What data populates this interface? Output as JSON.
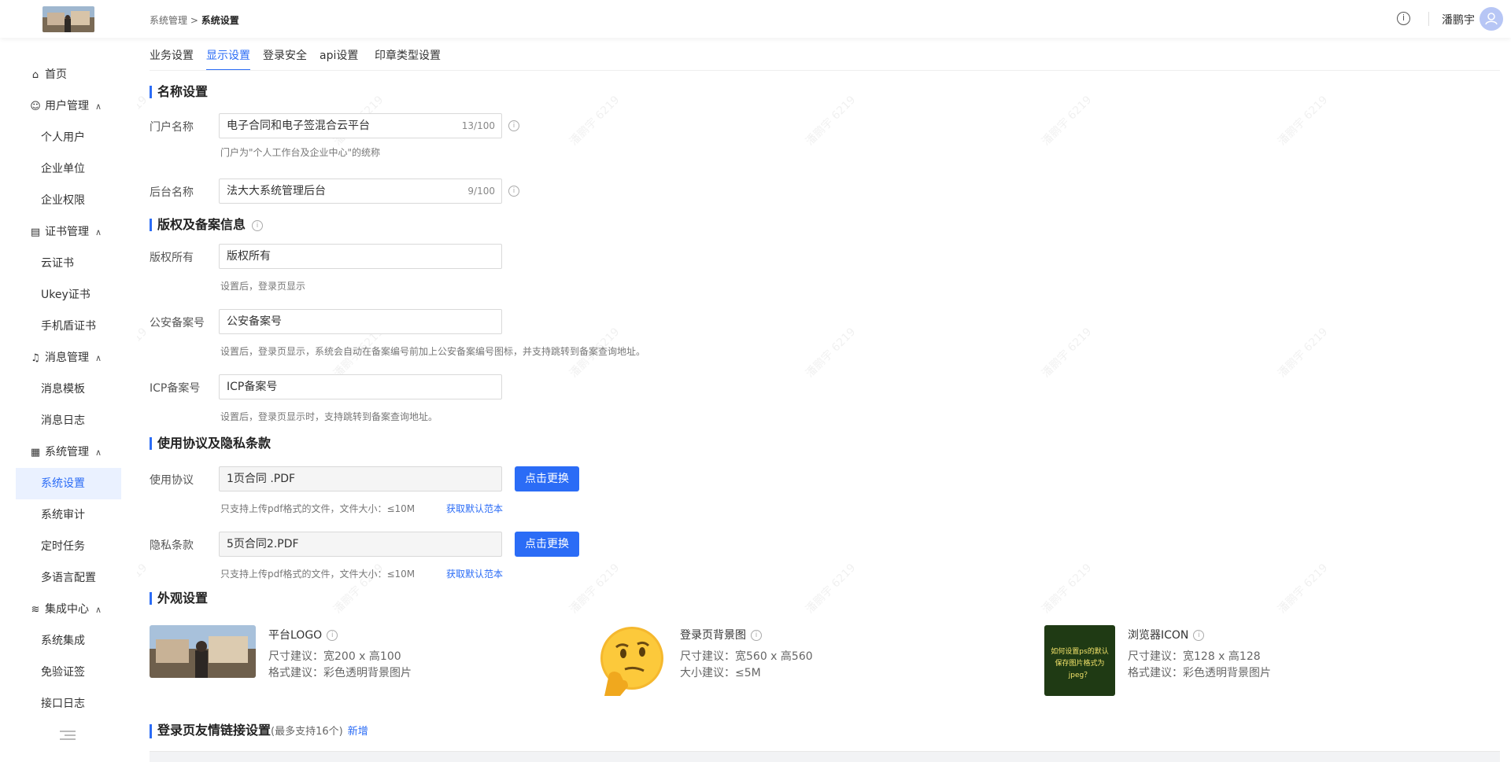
{
  "header": {
    "breadcrumb_parent": "系统管理",
    "breadcrumb_sep": ">",
    "breadcrumb_current": "系统设置",
    "info_icon": "info-circle-icon",
    "username": "潘鹏宇",
    "avatar_icon": "user-icon"
  },
  "sidebar": {
    "home": "首页",
    "user_mgmt": "用户管理",
    "personal_user": "个人用户",
    "enterprise_unit": "企业单位",
    "enterprise_perm": "企业权限",
    "cert_mgmt": "证书管理",
    "cloud_cert": "云证书",
    "ukey_cert": "Ukey证书",
    "mobile_shield_cert": "手机盾证书",
    "msg_mgmt": "消息管理",
    "msg_template": "消息模板",
    "msg_log": "消息日志",
    "sys_mgmt": "系统管理",
    "sys_settings": "系统设置",
    "sys_audit": "系统审计",
    "scheduled_tasks": "定时任务",
    "multilang": "多语言配置",
    "integration_center": "集成中心",
    "sys_integration": "系统集成",
    "exempt_cert": "免验证签",
    "api_log": "接口日志",
    "active_item": "系统设置"
  },
  "tabs": [
    "业务设置",
    "显示设置",
    "登录安全",
    "api设置",
    "印章类型设置"
  ],
  "active_tab": "显示设置",
  "name_section": {
    "title": "名称设置",
    "portal_label": "门户名称",
    "portal_value": "电子合同和电子签混合云平台",
    "portal_count": "13/100",
    "portal_hint": "门户为\"个人工作台及企业中心\"的统称",
    "admin_label": "后台名称",
    "admin_value": "法大大系统管理后台",
    "admin_count": "9/100"
  },
  "copyright_section": {
    "title": "版权及备案信息",
    "copyright_label": "版权所有",
    "copyright_value": "版权所有",
    "copyright_hint": "设置后，登录页显示",
    "police_label": "公安备案号",
    "police_value": "公安备案号",
    "police_hint": "设置后，登录页显示，系统会自动在备案编号前加上公安备案编号图标，并支持跳转到备案查询地址。",
    "icp_label": "ICP备案号",
    "icp_value": "ICP备案号",
    "icp_hint": "设置后，登录页显示时，支持跳转到备案查询地址。"
  },
  "agreement_section": {
    "title": "使用协议及隐私条款",
    "usage_label": "使用协议",
    "usage_value": "1页合同 .PDF",
    "usage_button": "点击更换",
    "usage_hint": "只支持上传pdf格式的文件，文件大小：≤10M",
    "usage_link": "获取默认范本",
    "privacy_label": "隐私条款",
    "privacy_value": "5页合同2.PDF",
    "privacy_button": "点击更换",
    "privacy_hint": "只支持上传pdf格式的文件，文件大小：≤10M",
    "privacy_link": "获取默认范本"
  },
  "appearance_section": {
    "title": "外观设置",
    "logo_name": "平台LOGO",
    "logo_size": "尺寸建议：宽200 x 高100",
    "logo_format": "格式建议：彩色透明背景图片",
    "bg_name": "登录页背景图",
    "bg_size": "尺寸建议：宽560 x 高560",
    "bg_filesize": "大小建议：≤5M",
    "icon_name": "浏览器ICON",
    "icon_size": "尺寸建议：宽128 x 高128",
    "icon_format": "格式建议：彩色透明背景图片",
    "icon_image_text": "如何设置ps的默认保存图片格式为jpeg？"
  },
  "links_section": {
    "title": "登录页友情链接设置",
    "subtitle": "(最多支持16个)",
    "add_link": "新增"
  },
  "watermark_text": "潘鹏宇 6219",
  "colors": {
    "accent": "#2b6cf6",
    "active_bg": "#eaf1ff"
  }
}
